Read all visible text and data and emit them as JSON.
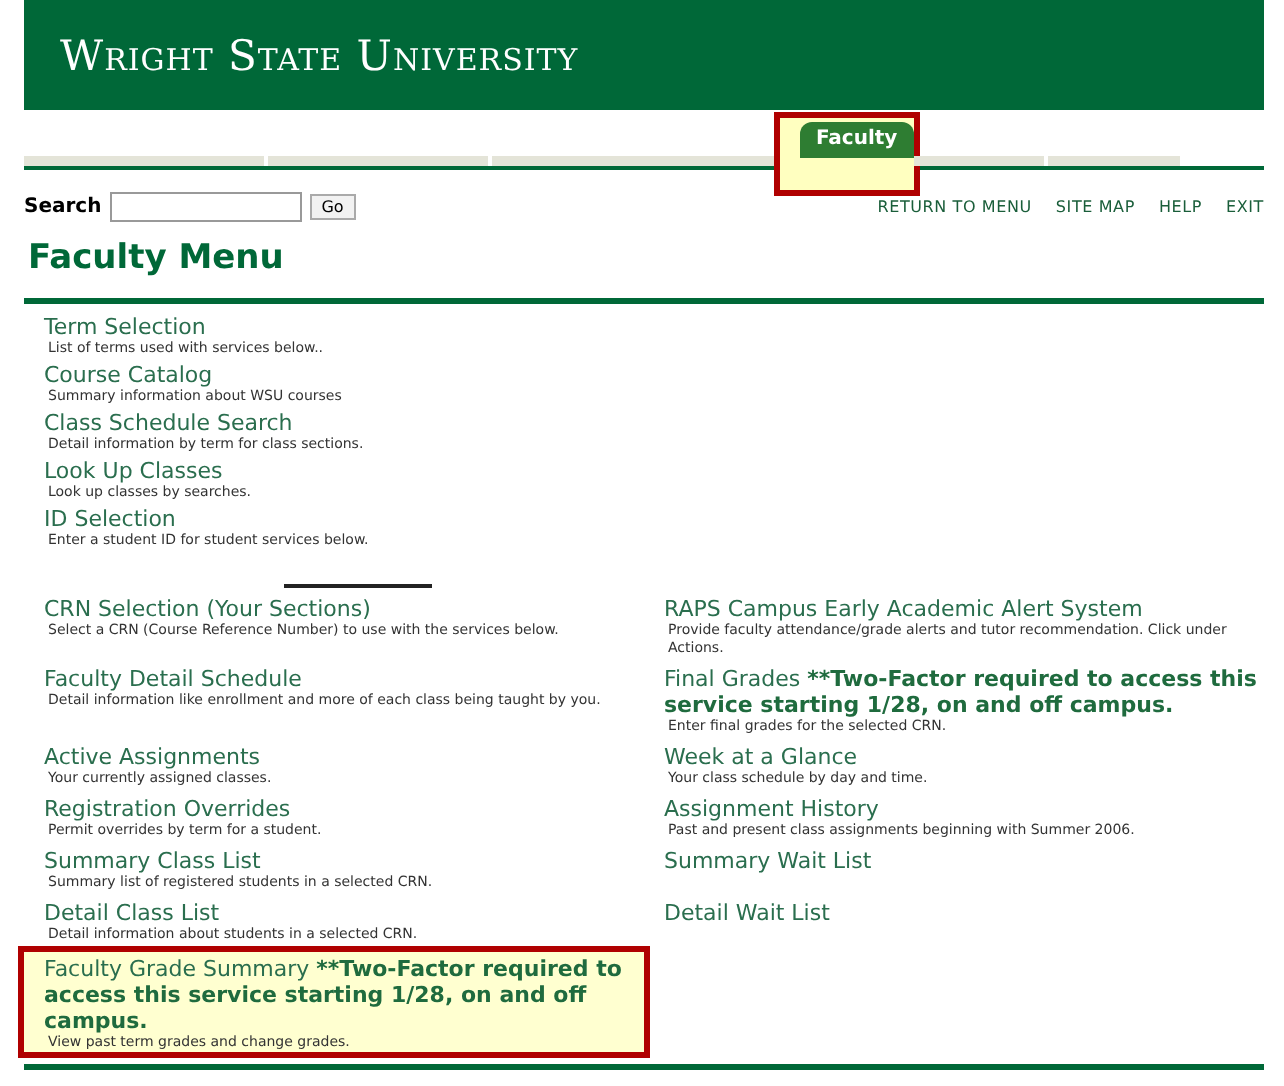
{
  "banner": {
    "title": "Wright State University"
  },
  "tabs": [
    {
      "label": "Faculty",
      "selected": true,
      "highlighted": true
    }
  ],
  "search": {
    "label": "Search",
    "button": "Go"
  },
  "nav_links": [
    "RETURN TO MENU",
    "SITE MAP",
    "HELP",
    "EXIT"
  ],
  "page_title": "Faculty Menu",
  "top_items": [
    {
      "title": "Term Selection",
      "description": "List of terms used with services below.."
    },
    {
      "title": "Course Catalog",
      "description": "Summary information about WSU courses"
    },
    {
      "title": "Class Schedule Search",
      "description": "Detail information by term for class sections."
    },
    {
      "title": "Look Up Classes",
      "description": "Look up classes by searches."
    },
    {
      "title": "ID Selection",
      "description": "Enter a student ID for student services below."
    }
  ],
  "left_items": [
    {
      "title": "CRN Selection (Your Sections)",
      "description": "Select a CRN (Course Reference Number) to use with the services below.",
      "highlighted": false
    },
    {
      "title": "Faculty Detail Schedule",
      "description": "Detail information like enrollment and more of each class being taught by you.",
      "highlighted": false
    },
    {
      "title": "Active Assignments",
      "description": "Your currently assigned classes.",
      "highlighted": false
    },
    {
      "title": "Registration Overrides",
      "description": "Permit overrides by term for a student.",
      "highlighted": false
    },
    {
      "title": "Summary Class List",
      "description": "Summary list of registered students in a selected CRN.",
      "highlighted": false
    },
    {
      "title": "Detail Class List",
      "description": "Detail information about students in a selected CRN.",
      "highlighted": false
    },
    {
      "title": "Faculty Grade Summary",
      "note": "**Two-Factor required to access this service starting 1/28, on and off campus.",
      "description": "View past term grades and change grades.",
      "highlighted": true
    }
  ],
  "right_items": [
    {
      "title": "RAPS Campus Early Academic Alert System",
      "description": "Provide faculty attendance/grade alerts and tutor recommendation. Click under Actions."
    },
    {
      "title": "Final Grades",
      "note": "**Two-Factor required to access this service starting 1/28, on and off campus.",
      "description": "Enter final grades for the selected CRN."
    },
    {
      "title": "Week at a Glance",
      "description": "Your class schedule by day and time."
    },
    {
      "title": "Assignment History",
      "description": "Past and present class assignments beginning with Summer 2006."
    },
    {
      "title": "Summary Wait List"
    },
    {
      "title": "Detail Wait List"
    }
  ]
}
